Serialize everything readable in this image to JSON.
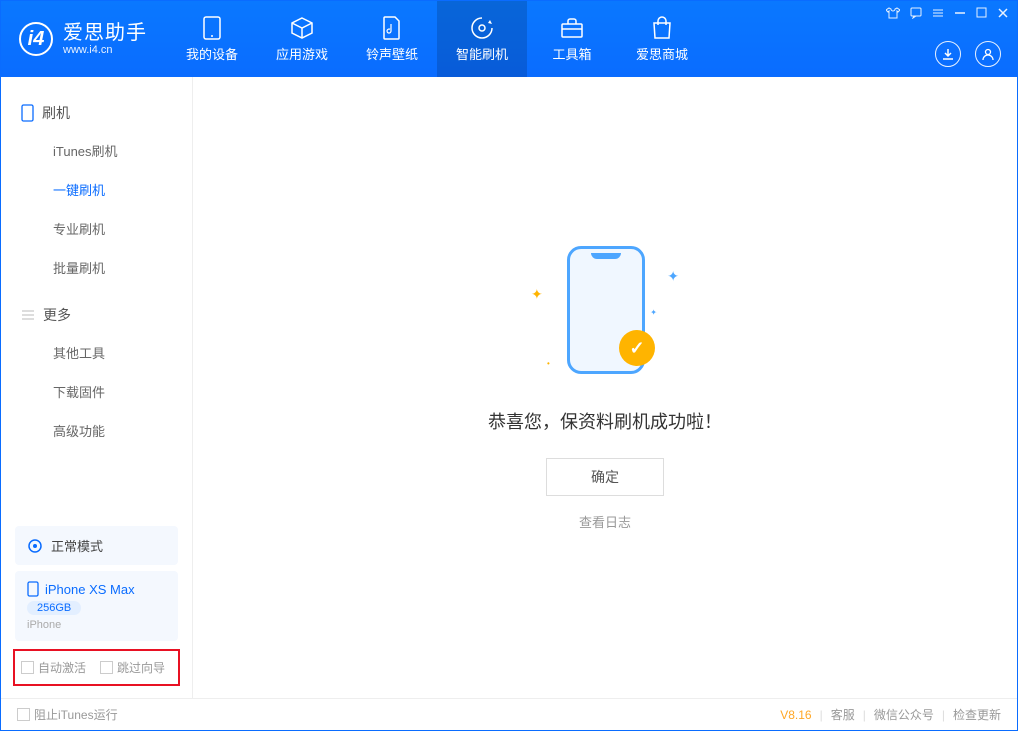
{
  "app": {
    "title": "爱思助手",
    "site": "www.i4.cn"
  },
  "nav": {
    "items": [
      {
        "label": "我的设备"
      },
      {
        "label": "应用游戏"
      },
      {
        "label": "铃声壁纸"
      },
      {
        "label": "智能刷机"
      },
      {
        "label": "工具箱"
      },
      {
        "label": "爱思商城"
      }
    ]
  },
  "sidebar": {
    "section1": {
      "title": "刷机",
      "items": [
        "iTunes刷机",
        "一键刷机",
        "专业刷机",
        "批量刷机"
      ]
    },
    "section2": {
      "title": "更多",
      "items": [
        "其他工具",
        "下载固件",
        "高级功能"
      ]
    },
    "mode": "正常模式",
    "device": {
      "name": "iPhone XS Max",
      "capacity": "256GB",
      "type": "iPhone"
    },
    "checkboxes": {
      "auto_activate": "自动激活",
      "skip_guide": "跳过向导"
    }
  },
  "main": {
    "success_text": "恭喜您，保资料刷机成功啦！",
    "ok_button": "确定",
    "view_log": "查看日志"
  },
  "footer": {
    "block_itunes": "阻止iTunes运行",
    "version": "V8.16",
    "links": [
      "客服",
      "微信公众号",
      "检查更新"
    ]
  }
}
